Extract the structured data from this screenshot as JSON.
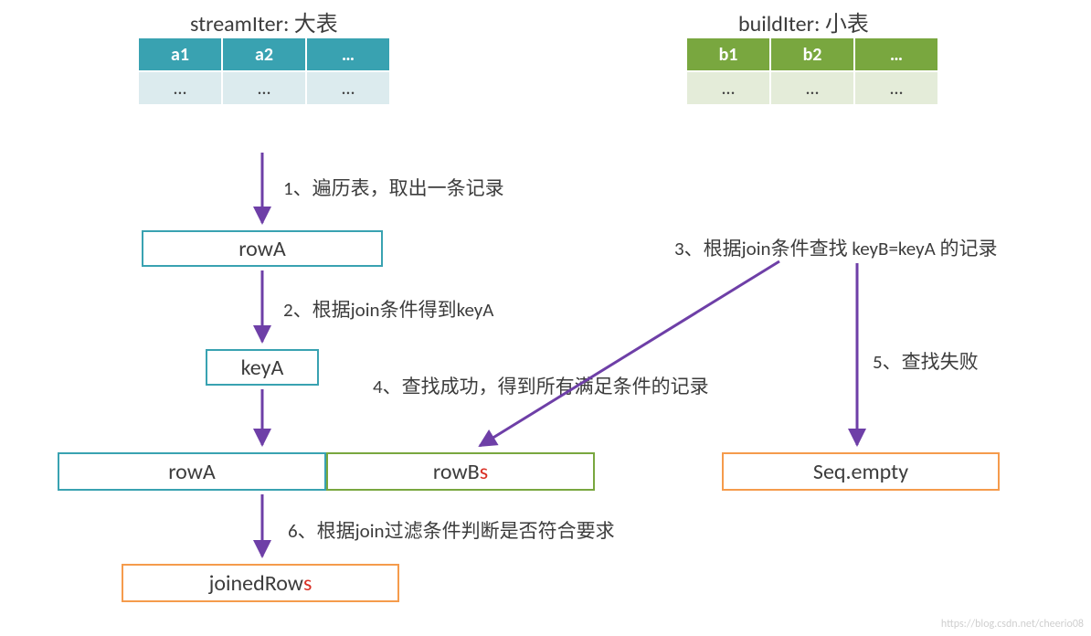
{
  "titles": {
    "stream": "streamIter: 大表",
    "build": "buildIter: 小表"
  },
  "tableA": {
    "headers": [
      "a1",
      "a2",
      "…"
    ],
    "row": [
      "…",
      "…",
      "…"
    ]
  },
  "tableB": {
    "headers": [
      "b1",
      "b2",
      "…"
    ],
    "row": [
      "…",
      "…",
      "…"
    ]
  },
  "boxes": {
    "rowA1": "rowA",
    "keyA": "keyA",
    "rowA2": "rowA",
    "rowBs_prefix": "rowB",
    "rowBs_suffix": "s",
    "seq_empty": "Seq.empty",
    "joined_prefix": "joinedRow",
    "joined_suffix": "s"
  },
  "steps": {
    "s1": "1、遍历表，取出一条记录",
    "s2": "2、根据join条件得到keyA",
    "s3": "3、根据join条件查找 keyB=keyA 的记录",
    "s4": "4、查找成功，得到所有满足条件的记录",
    "s5": "5、查找失败",
    "s6": "6、根据join过滤条件判断是否符合要求"
  },
  "watermark": "https://blog.csdn.net/cheerio08"
}
